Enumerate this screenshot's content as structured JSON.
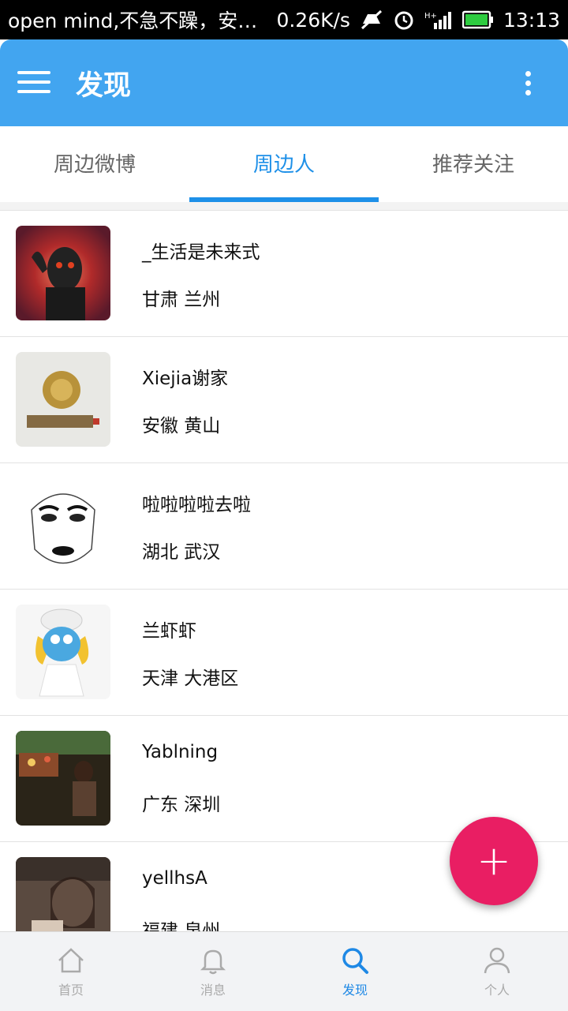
{
  "status_bar": {
    "notification": "open mind,不急不躁，安…",
    "speed": "0.26K/s",
    "time": "13:13"
  },
  "app_bar": {
    "title": "发现"
  },
  "tabs": [
    {
      "label": "周边微博"
    },
    {
      "label": "周边人"
    },
    {
      "label": "推荐关注"
    }
  ],
  "active_tab": "周边人",
  "people": [
    {
      "name": "_生活是未来式",
      "location": "甘肃 兰州"
    },
    {
      "name": "Xiejia谢家",
      "location": "安徽 黄山"
    },
    {
      "name": "啦啦啦啦去啦",
      "location": "湖北 武汉"
    },
    {
      "name": "兰虾虾",
      "location": "天津 大港区"
    },
    {
      "name": "Yablning",
      "location": "广东 深圳"
    },
    {
      "name": "yellhsA",
      "location": "福建 泉州"
    }
  ],
  "fab": {
    "label": "+"
  },
  "bottom_nav": [
    {
      "label": "首页",
      "icon": "home-icon"
    },
    {
      "label": "消息",
      "icon": "bell-icon"
    },
    {
      "label": "发现",
      "icon": "search-icon"
    },
    {
      "label": "个人",
      "icon": "person-icon"
    }
  ],
  "colors": {
    "primary": "#42a5f0",
    "tab_accent": "#1e90e8",
    "fab": "#e91e63"
  }
}
